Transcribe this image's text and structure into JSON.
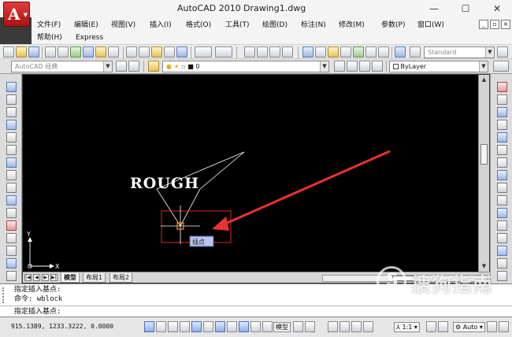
{
  "window": {
    "app_glyph": "A",
    "app_name": "AutoCAD 2010",
    "file_name": "Drawing1.dwg",
    "minimize": "—",
    "maximize": "☐",
    "close": "✕"
  },
  "menu": {
    "row1": [
      "文件(F)",
      "编辑(E)",
      "视图(V)",
      "插入(I)",
      "格式(O)",
      "工具(T)",
      "绘图(D)",
      "标注(N)",
      "修改(M)",
      "参数(P)",
      "窗口(W)"
    ],
    "row2": [
      "帮助(H)",
      "Express"
    ]
  },
  "toolbar": {
    "text_style": "Standard",
    "workspace": "AutoCAD 经典",
    "layer_value": "0",
    "color_value": "ByLayer"
  },
  "canvas": {
    "annotation_text": "ROUGH",
    "tooltip": "插点",
    "ucs_x": "X",
    "ucs_y": "Y",
    "colors": {
      "background": "#000000",
      "arrow": "#e8332e",
      "box": "#d92b2b",
      "marker": "#f08a1d",
      "lines": "#ffffff"
    }
  },
  "layout_tabs": [
    {
      "label": "模型",
      "active": true
    },
    {
      "label": "布局1",
      "active": false
    },
    {
      "label": "布局2",
      "active": false
    }
  ],
  "command": {
    "history": [
      "指定插入基点:",
      "命令: wblock"
    ],
    "prompt": "指定插入基点:"
  },
  "status": {
    "coordinates": "915.1389,  1233.3222, 0.0000",
    "model": "模型",
    "scale": "1:1",
    "auto": "Auto"
  },
  "watermark": {
    "cn": "搜狗指南",
    "en": "zhinan.sogou.com",
    "logo_glyph": "S"
  }
}
